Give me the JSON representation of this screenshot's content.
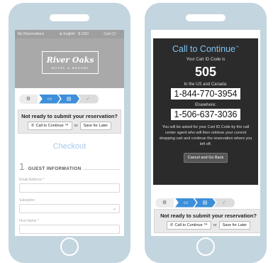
{
  "left_screen": {
    "topbar": {
      "reservations": "My Reservations",
      "language": "English",
      "currency": "USD",
      "cart": "Cart (1)"
    },
    "logo": {
      "title": "River Oaks",
      "subtitle": "HOTEL & RESORT"
    },
    "steps": {
      "first_icon": "settings-icon",
      "second_icon": "cart-icon",
      "third_icon": "card-icon",
      "fourth_icon": "check-icon"
    },
    "notice": {
      "title": "Not ready to submit your reservation?",
      "call_label": "Call to Continue ™",
      "or_label": "or",
      "save_label": "Save for Later"
    },
    "checkout_title": "Checkout",
    "section": {
      "number": "1",
      "label": "GUEST INFORMATION"
    },
    "fields": {
      "email_label": "Email Address *",
      "salutation_label": "Salutation",
      "first_name_label": "First Name *"
    }
  },
  "right_screen": {
    "overlay": {
      "title": "Call to Continue",
      "title_mark": "™",
      "code_label": "Your Cart ID Code is",
      "code": "505",
      "us_label": "In the US and Canada:",
      "us_phone": "1-844-770-3954",
      "else_label": "Elsewhere:",
      "else_phone": "1-506-637-3036",
      "info": "You will be asked for your Cart ID Code by the call center agent who will then retrieve your current shopping cart and continue the reservation where you left off.",
      "cancel_label": "Cancel and Go Back"
    },
    "notice": {
      "title": "Not ready to submit your reservation?",
      "call_label": "Call to Continue ™",
      "or_label": "or",
      "save_label": "Save for Later"
    }
  },
  "colors": {
    "accent_blue": "#3d8fd9",
    "overlay_bg": "#2b2b2b",
    "phone_frame": "#c3d5df",
    "checkout_title": "#a9c6e8"
  }
}
